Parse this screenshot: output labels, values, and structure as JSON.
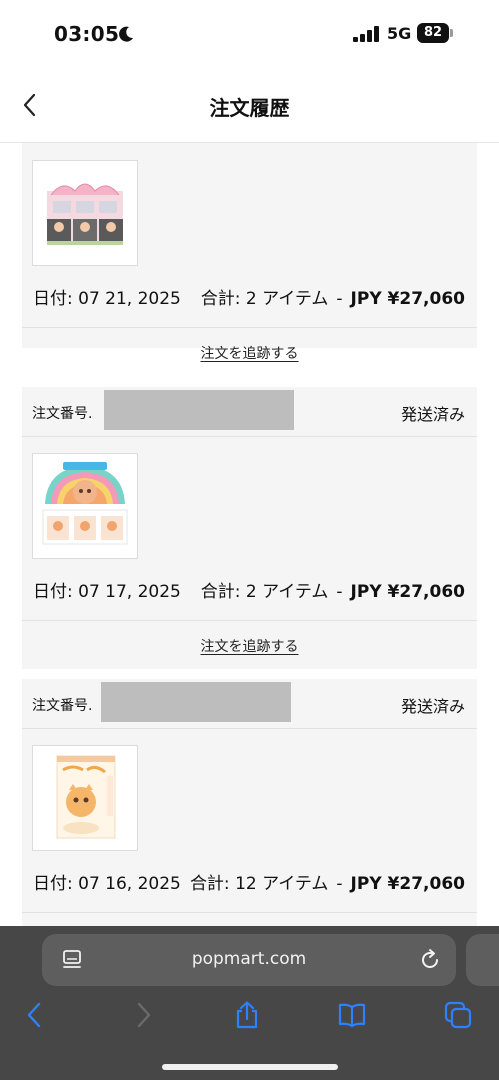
{
  "status_bar": {
    "time": "03:05",
    "network": "5G",
    "battery": "82"
  },
  "nav": {
    "title": "注文履歴"
  },
  "orders": [
    {
      "order_label": "",
      "status": "",
      "date": "日付: 07 21, 2025",
      "total_count": "合計: 2 アイテム",
      "dash": "-",
      "amount": "JPY ¥27,060",
      "track_label": "注文を追跡する"
    },
    {
      "order_label": "注文番号.",
      "status": "発送済み",
      "date": "日付: 07 17, 2025",
      "total_count": "合計: 2 アイテム",
      "dash": "-",
      "amount": "JPY ¥27,060",
      "track_label": "注文を追跡する"
    },
    {
      "order_label": "注文番号.",
      "status": "発送済み",
      "date": "日付: 07 16, 2025",
      "total_count": "合計: 12 アイテム",
      "dash": "-",
      "amount": "JPY ¥27,060",
      "track_label": ""
    }
  ],
  "product_images": [
    "pink-blind-box-set-image",
    "rainbow-monster-blind-box-image",
    "hoshi-seal-blind-box-image"
  ],
  "browser": {
    "url": "popmart.com",
    "toolbar_icons": [
      "back-arrow-icon",
      "forward-arrow-icon",
      "share-icon",
      "bookmarks-icon",
      "tabs-icon"
    ],
    "accent_color": "#2f80ff"
  }
}
